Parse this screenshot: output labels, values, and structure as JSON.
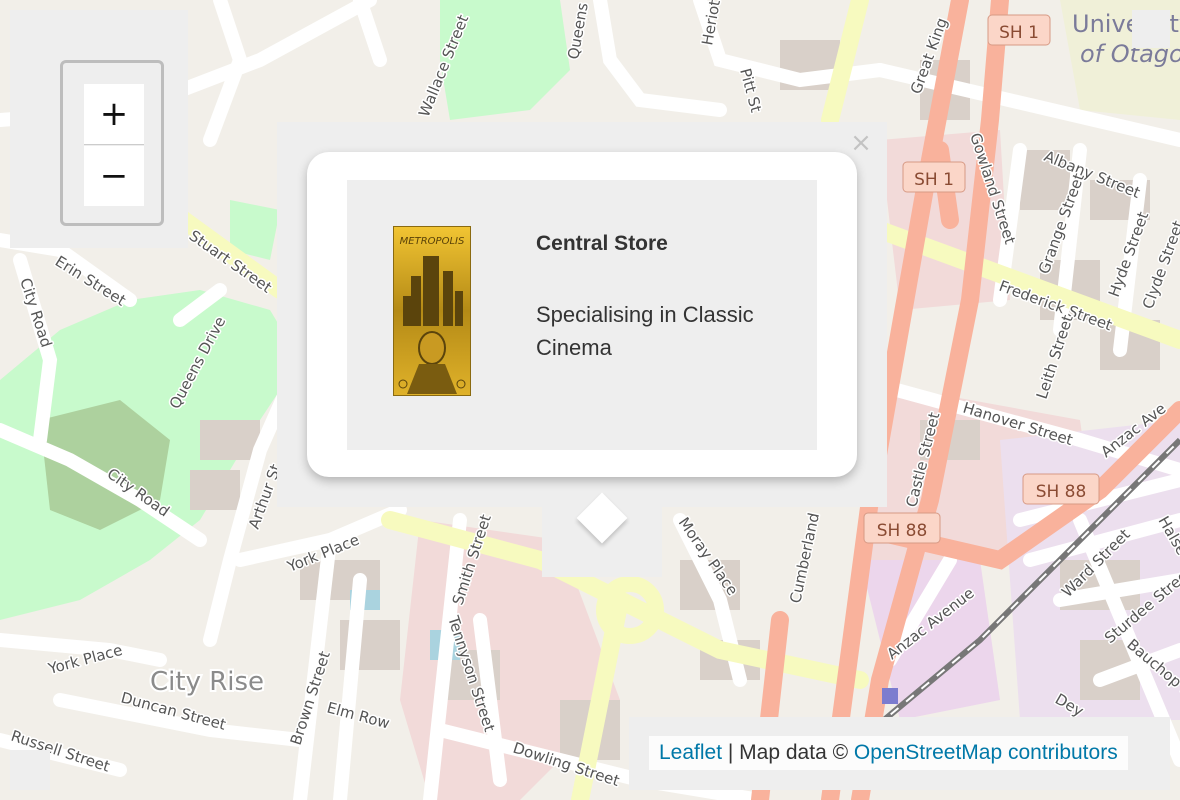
{
  "map": {
    "suburb": "City Rise",
    "university": [
      "University",
      "of Otago"
    ],
    "shields": {
      "sh1": "SH 1",
      "sh88": "SH 88"
    },
    "streets": {
      "wallace": "Wallace Street",
      "queens": "Queens",
      "heriot": "Heriot",
      "pitt": "Pitt St",
      "great_king": "Great King",
      "gowland": "Gowland Street",
      "albany": "Albany Street",
      "grange": "Grange Street",
      "hyde": "Hyde Street",
      "clyde": "Clyde Street",
      "frederick": "Frederick Street",
      "stuart": "Stuart Street",
      "erin": "Erin Street",
      "city_road_1": "City Road",
      "city_road_2": "City Road",
      "queens_drive": "Queens Drive",
      "arthur": "Arthur St",
      "york_place_1": "York Place",
      "york_place_2": "York Place",
      "smith": "Smith Street",
      "tennyson": "Tennyson Street",
      "moray_place": "Moray Place",
      "cumberland": "Cumberland",
      "castle": "Castle Street",
      "hanover": "Hanover Street",
      "leith": "Leith Street",
      "anzac_1": "Anzac Ave",
      "anzac_2": "Anzac Avenue",
      "ward": "Ward Street",
      "halsey": "Halse",
      "sturdee": "Sturdee Stree",
      "bauchop": "Bauchop S",
      "dowling": "Dowling Street",
      "brown": "Brown Street",
      "elm_row": "Elm Row",
      "duncan": "Duncan Street",
      "russell": "Russell Street",
      "dey": "Dey"
    }
  },
  "zoom": {
    "in_label": "+",
    "out_label": "−"
  },
  "popup": {
    "close_label": "×",
    "poster_text": "METROPOLIS",
    "title": "Central Store",
    "description": "Specialising in Classic Cinema"
  },
  "attribution": {
    "leaflet": "Leaflet",
    "separator": " | Map data © ",
    "osm": "OpenStreetMap contributors"
  },
  "colors": {
    "primary_road": "#f9b29c",
    "secondary_road": "#f7fabf",
    "park": "#c8facc",
    "building": "#d9d0c9",
    "link": "#0078a8"
  }
}
